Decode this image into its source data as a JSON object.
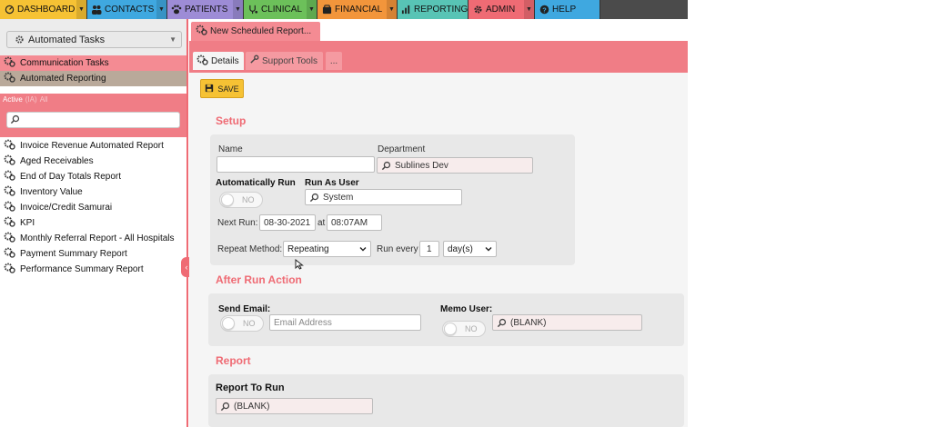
{
  "nav": {
    "tabs": [
      {
        "label": "DASHBOARD",
        "icon": "dashboard-icon",
        "color": "#f6c234"
      },
      {
        "label": "CONTACTS",
        "icon": "contacts-icon",
        "color": "#3fa8e0"
      },
      {
        "label": "PATIENTS",
        "icon": "paw-icon",
        "color": "#9d8cd6"
      },
      {
        "label": "CLINICAL",
        "icon": "stethoscope-icon",
        "color": "#6cc05a"
      },
      {
        "label": "FINANCIAL",
        "icon": "money-icon",
        "color": "#f2953b"
      },
      {
        "label": "REPORTING",
        "icon": "chart-icon",
        "color": "#58c4b5"
      },
      {
        "label": "ADMIN",
        "icon": "gear-icon",
        "color": "#ef6b74"
      },
      {
        "label": "HELP",
        "icon": "help-icon",
        "color": "#3fa8e0"
      }
    ]
  },
  "sidebar": {
    "module_select": "Automated Tasks",
    "categories": [
      "Communication Tasks",
      "Automated Reporting"
    ],
    "filter": {
      "active": "Active",
      "other": [
        "(IA)",
        "All"
      ]
    },
    "items": [
      "Invoice Revenue Automated Report",
      "Aged Receivables",
      "End of Day Totals Report",
      "Inventory Value",
      "Invoice/Credit Samurai",
      "KPI",
      "Monthly Referral Report - All Hospitals",
      "Payment Summary Report",
      "Performance Summary Report"
    ],
    "collapse_glyph": "‹"
  },
  "main": {
    "doc_tab": "New Scheduled Report...",
    "subtabs": {
      "details": "Details",
      "support": "Support Tools",
      "more": "..."
    },
    "save_label": "SAVE",
    "setup": {
      "title": "Setup",
      "name_label": "Name",
      "name_value": "",
      "department_label": "Department",
      "department_value": "Sublines Dev",
      "auto_run_label": "Automatically Run",
      "auto_run_state": "NO",
      "run_as_user_label": "Run As User",
      "run_as_user_value": "System",
      "next_run_label": "Next Run:",
      "next_run_date": "08-30-2021",
      "at_label": "at",
      "next_run_time": "08:07AM",
      "repeat_method_label": "Repeat Method:",
      "repeat_method_value": "Repeating",
      "run_every_label": "Run every",
      "run_every_value": "1",
      "run_every_unit": "day(s)"
    },
    "after_run": {
      "title": "After Run Action",
      "send_email_label": "Send Email:",
      "send_email_state": "NO",
      "email_placeholder": "Email Address",
      "memo_user_label": "Memo User:",
      "memo_user_state": "NO",
      "memo_user_value": "(BLANK)"
    },
    "report": {
      "title": "Report",
      "report_to_run_label": "Report To Run",
      "report_to_run_value": "(BLANK)"
    }
  },
  "colors": {
    "accent": "#ef6b74",
    "save": "#f6c234",
    "panel": "#e8e8e8",
    "nav_bg": "#4b4b4b"
  }
}
